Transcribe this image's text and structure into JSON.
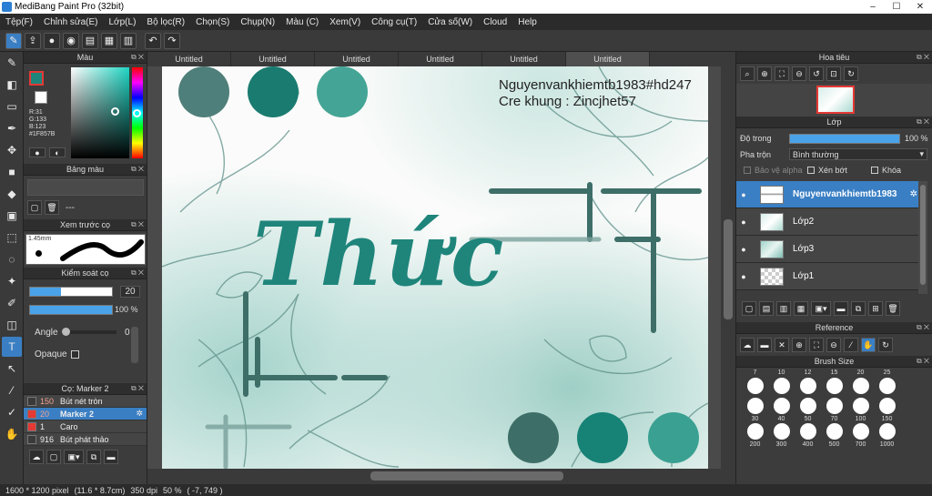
{
  "window": {
    "title": "MediBang Paint Pro (32bit)",
    "buttons": [
      "–",
      "☐",
      "✕"
    ]
  },
  "menu": [
    "Tệp(F)",
    "Chỉnh sửa(E)",
    "Lớp(L)",
    "Bộ lọc(R)",
    "Chọn(S)",
    "Chụp(N)",
    "Màu (C)",
    "Xem(V)",
    "Công cụ(T)",
    "Cửa số(W)",
    "Cloud",
    "Help"
  ],
  "toolbar_icons": [
    "brush-mode-icon",
    "export-icon",
    "comment-icon",
    "speech-bubble-icon",
    "page-icon",
    "grid-page-icon",
    "layout-icon",
    "undo-icon",
    "redo-icon"
  ],
  "tools": [
    "brush",
    "eraser",
    "rectangle",
    "pen",
    "move",
    "fill-rect",
    "bucket",
    "gradient",
    "select-rect",
    "lasso",
    "magic-wand",
    "select-pen",
    "select-eraser",
    "text",
    "operation",
    "eyedropper",
    "dropper-2",
    "hand"
  ],
  "color_panel": {
    "title": "Màu",
    "r": "R:31",
    "g": "G:133",
    "b": "B:123",
    "hex": "#1F857B",
    "fg": "#1F857B",
    "bg": "#ffffff"
  },
  "palette_panel": {
    "title": "Bảng màu",
    "value": "---"
  },
  "preview_panel": {
    "title": "Xem trước cọ",
    "size": "1.45mm"
  },
  "brush_control": {
    "title": "Kiểm soát cọ",
    "size": "20",
    "opacity": "100 %",
    "angle_label": "Angle",
    "angle": "0",
    "opaque_label": "Opaque"
  },
  "brush_list": {
    "title": "Cọ: Marker 2",
    "items": [
      {
        "num": "150",
        "name": "Bút nét tròn",
        "color": "#3a3a3a"
      },
      {
        "num": "20",
        "name": "Marker 2",
        "color": "#e53935"
      },
      {
        "num": "1",
        "name": "Caro",
        "color": "#e53935"
      },
      {
        "num": "916",
        "name": "Bút phát thảo",
        "color": "#3a3a3a"
      }
    ]
  },
  "tabs": [
    "Untitled",
    "Untitled",
    "Untitled",
    "Untitled",
    "Untitled",
    "Untitled"
  ],
  "canvas": {
    "credit1": "Nguyenvankhiemtb1983#hd247",
    "credit2": "Cre khung : Zincjhet57",
    "word": "Thức",
    "top_swatches": [
      "#4f7f7a",
      "#1a7b70",
      "#44a596"
    ],
    "bottom_swatches": [
      "#3e6e68",
      "#178276",
      "#3aa192"
    ]
  },
  "navigator": {
    "title": "Hoa tiêu"
  },
  "layers_panel": {
    "title": "Lớp",
    "opacity_label": "Độ trong",
    "opacity": "100 %",
    "blend_label": "Pha trộn",
    "blend": "Bình thường",
    "protect_alpha": "Bảo vệ alpha",
    "clipping": "Xén bớt",
    "lock": "Khóa",
    "layers": [
      "Nguyenvankhiemtb1983",
      "Lớp2",
      "Lớp3",
      "Lớp1"
    ]
  },
  "reference": {
    "title": "Reference"
  },
  "brush_size": {
    "title": "Brush Size",
    "row1": [
      "7",
      "10",
      "12",
      "15",
      "20",
      "25"
    ],
    "row2": [
      "30",
      "40",
      "50",
      "70",
      "100",
      "150"
    ],
    "row3": [
      "200",
      "300",
      "400",
      "500",
      "700",
      "1000"
    ]
  },
  "status": {
    "dims": "1600 * 1200 pixel",
    "cm": "(11.6 * 8.7cm)",
    "dpi": "350 dpi",
    "zoom": "50 %",
    "coords": "( -7, 749 )"
  }
}
